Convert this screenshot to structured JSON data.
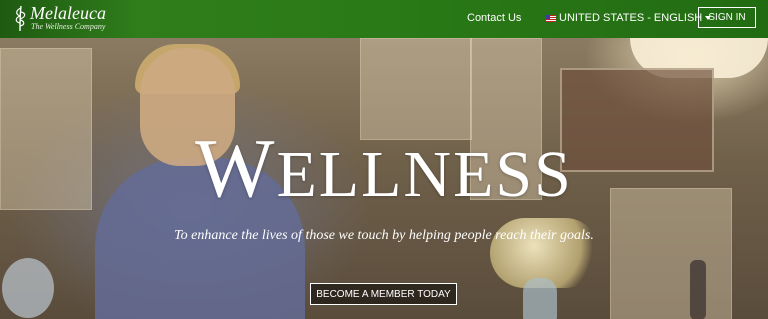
{
  "header": {
    "logo": {
      "name": "Melaleuca",
      "tagline": "The Wellness Company"
    },
    "contact_label": "Contact Us",
    "locale_label": "UNITED STATES - ENGLISH",
    "signin_label": "SIGN IN"
  },
  "hero": {
    "headline_first": "W",
    "headline_rest": "ELLNESS",
    "subtitle": "To enhance the lives of those we touch by helping people reach their goals.",
    "cta_label": "BECOME A MEMBER TODAY"
  },
  "colors": {
    "header_green": "#2a7a17",
    "text_white": "#ffffff"
  },
  "icons": {
    "logo": "leaf-icon",
    "flag": "us-flag-icon",
    "caret": "caret-down-icon"
  }
}
